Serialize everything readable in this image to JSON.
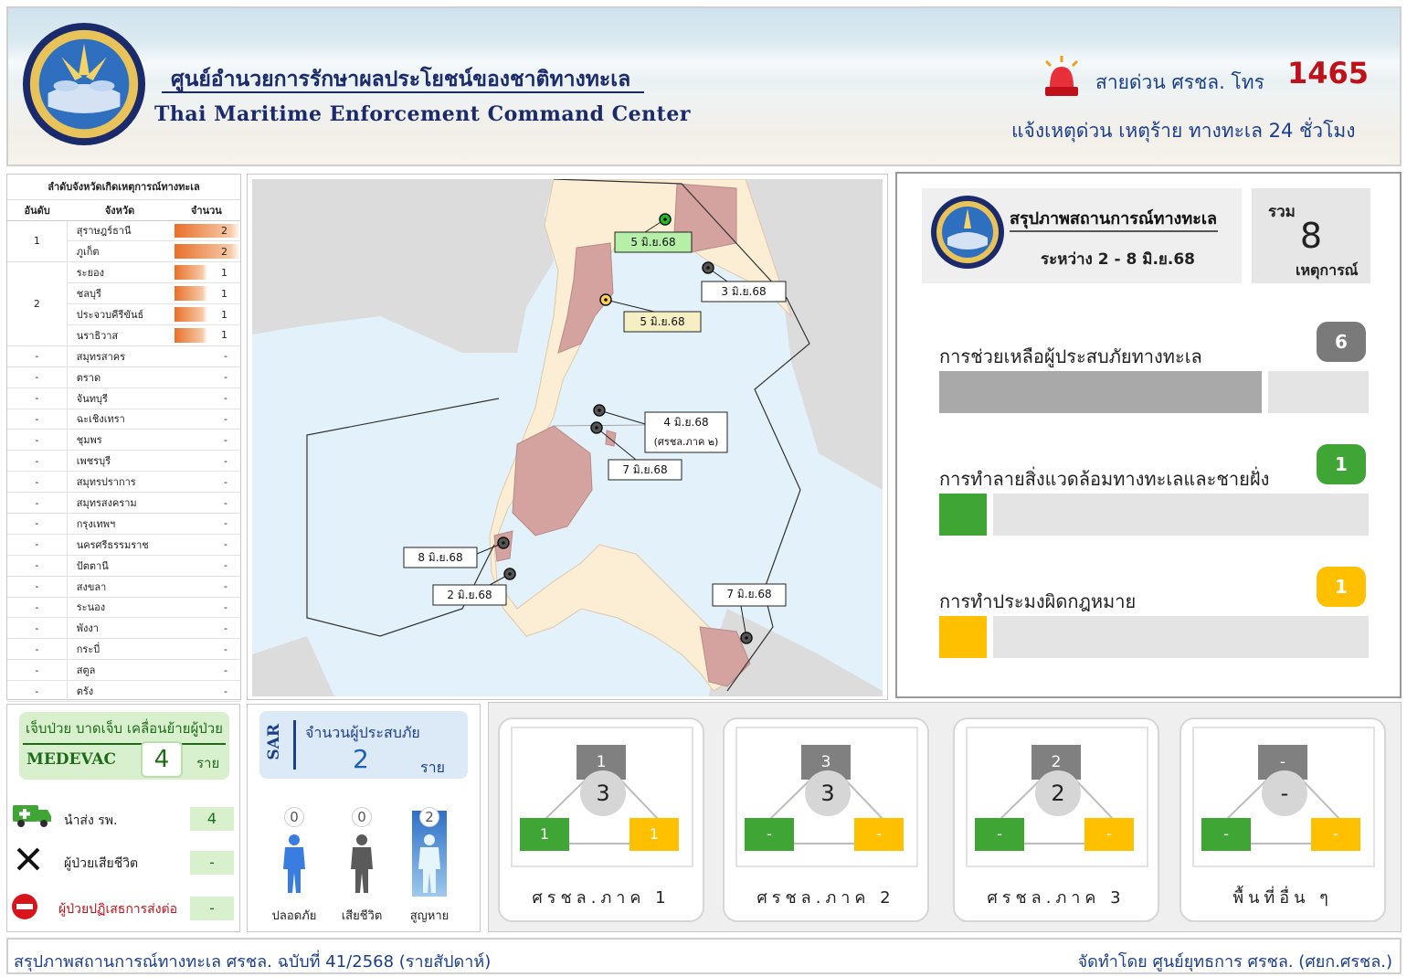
{
  "header": {
    "title_th": "ศูนย์อำนวยการรักษาผลประโยชน์ของชาติทางทะเล",
    "title_en": "Thai Maritime Enforcement Command Center",
    "hotline_label": "สายด่วน ศรชล. โทร",
    "hotline_number": "1465",
    "hotline_sub": "แจ้งเหตุด่วน เหตุร้าย ทางทะเล 24 ชั่วโมง"
  },
  "ranking": {
    "title": "ลำดับจังหวัดเกิดเหตุการณ์ทางทะเล",
    "headers": [
      "อันดับ",
      "จังหวัด",
      "จำนวน"
    ],
    "groups": [
      {
        "rank": "1",
        "rows": [
          {
            "province": "สุราษฎร์ธานี",
            "count": "2"
          },
          {
            "province": "ภูเก็ต",
            "count": "2"
          }
        ]
      },
      {
        "rank": "2",
        "rows": [
          {
            "province": "ระยอง",
            "count": "1"
          },
          {
            "province": "ชลบุรี",
            "count": "1"
          },
          {
            "province": "ประจวบคีรีขันธ์",
            "count": "1"
          },
          {
            "province": "นราธิวาส",
            "count": "1"
          }
        ]
      }
    ],
    "others": [
      {
        "rank": "-",
        "province": "สมุทรสาคร",
        "count": "-"
      },
      {
        "rank": "-",
        "province": "ตราด",
        "count": "-"
      },
      {
        "rank": "-",
        "province": "จันทบุรี",
        "count": "-"
      },
      {
        "rank": "-",
        "province": "ฉะเชิงเทรา",
        "count": "-"
      },
      {
        "rank": "-",
        "province": "ชุมพร",
        "count": "-"
      },
      {
        "rank": "-",
        "province": "เพชรบุรี",
        "count": "-"
      },
      {
        "rank": "-",
        "province": "สมุทรปราการ",
        "count": "-"
      },
      {
        "rank": "-",
        "province": "สมุทรสงคราม",
        "count": "-"
      },
      {
        "rank": "-",
        "province": "กรุงเทพฯ",
        "count": "-"
      },
      {
        "rank": "-",
        "province": "นครศรีธรรมราช",
        "count": "-"
      },
      {
        "rank": "-",
        "province": "ปัตตานี",
        "count": "-"
      },
      {
        "rank": "-",
        "province": "สงขลา",
        "count": "-"
      },
      {
        "rank": "-",
        "province": "ระนอง",
        "count": "-"
      },
      {
        "rank": "-",
        "province": "พังงา",
        "count": "-"
      },
      {
        "rank": "-",
        "province": "กระบี่",
        "count": "-"
      },
      {
        "rank": "-",
        "province": "สตูล",
        "count": "-"
      },
      {
        "rank": "-",
        "province": "ตรัง",
        "count": "-"
      }
    ]
  },
  "map": {
    "markers": [
      {
        "label": "5 มิ.ย.68",
        "color": "#22bb22",
        "box": "#b6f0a8"
      },
      {
        "label": "3 มิ.ย.68",
        "color": "#555555",
        "box": "#ffffff"
      },
      {
        "label": "5 มิ.ย.68",
        "color": "#ffd060",
        "box": "#f7efc4"
      },
      {
        "label": "4 มิ.ย.68",
        "sub": "(ศรชล.ภาค ๒)",
        "color": "#555555",
        "box": "#ffffff"
      },
      {
        "label": "7 มิ.ย.68",
        "color": "#555555",
        "box": "#ffffff"
      },
      {
        "label": "8 มิ.ย.68",
        "color": "#555555",
        "box": "#ffffff"
      },
      {
        "label": "2 มิ.ย.68",
        "color": "#555555",
        "box": "#ffffff"
      },
      {
        "label": "7 มิ.ย.68",
        "color": "#555555",
        "box": "#ffffff"
      }
    ]
  },
  "summary": {
    "title": "สรุปภาพสถานการณ์ทางทะเล",
    "range": "ระหว่าง 2 - 8  มิ.ย.68",
    "total_label": "รวม",
    "total": "8",
    "total_unit": "เหตุการณ์",
    "categories": [
      {
        "label": "การช่วยเหลือผู้ประสบภัยทางทะเล",
        "count": "6",
        "share": 0.75,
        "color": "#a9a9a9",
        "badge": "#7a7a7a"
      },
      {
        "label": "การทำลายสิ่งแวดล้อมทางทะเลและชายฝั่ง",
        "count": "1",
        "share": 0.11,
        "color": "#3fa535",
        "badge": "#3fa535"
      },
      {
        "label": "การทำประมงผิดกฎหมาย",
        "count": "1",
        "share": 0.11,
        "color": "#ffc000",
        "badge": "#ffc000"
      }
    ]
  },
  "medevac": {
    "title": "เจ็บป่วย บาดเจ็บ เคลื่อนย้ายผู้ป่วย",
    "word": "MEDEVAC",
    "count": "4",
    "unit": "ราย",
    "rows": [
      {
        "label": "นำส่ง รพ.",
        "value": "4"
      },
      {
        "label": "ผู้ป่วยเสียชีวิต",
        "value": "-"
      },
      {
        "label": "ผู้ป่วยปฏิเสธการส่งต่อ",
        "value": "-"
      }
    ]
  },
  "sar": {
    "word": "SAR",
    "title": "จำนวนผู้ประสบภัย",
    "count": "2",
    "unit": "ราย",
    "people": [
      {
        "label": "ปลอดภัย",
        "count": "0",
        "color": "#3a7de0"
      },
      {
        "label": "เสียชีวิต",
        "count": "0",
        "color": "#5a5a5a"
      },
      {
        "label": "สูญหาย",
        "count": "2",
        "color": "#d8eefa"
      }
    ]
  },
  "regions": [
    {
      "name": "ศรชล.ภาค 1",
      "top": "1",
      "total": "3",
      "green": "1",
      "yellow": "1"
    },
    {
      "name": "ศรชล.ภาค 2",
      "top": "3",
      "total": "3",
      "green": "-",
      "yellow": "-"
    },
    {
      "name": "ศรชล.ภาค 3",
      "top": "2",
      "total": "2",
      "green": "-",
      "yellow": "-"
    },
    {
      "name": "พื้นที่อื่น ๆ",
      "top": "-",
      "total": "-",
      "green": "-",
      "yellow": "-"
    }
  ],
  "footer": {
    "left": "สรุปภาพสถานการณ์ทางทะเล ศรชล. ฉบับที่ 41/2568 (รายสัปดาห์)",
    "right": "จัดทำโดย ศูนย์ยุทธการ ศรชล. (ศยก.ศรชล.)"
  },
  "icons": {
    "siren": "siren-icon",
    "ambulance": "ambulance-icon",
    "death": "x-mark-icon",
    "refuse": "no-entry-icon",
    "logo": "emblem-logo"
  }
}
